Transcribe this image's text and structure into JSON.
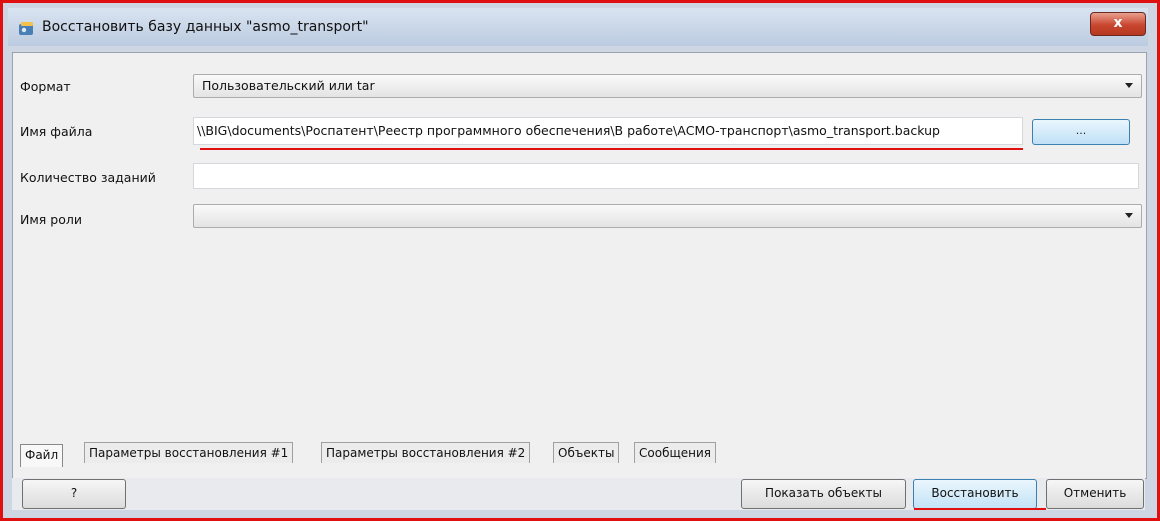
{
  "window": {
    "title": "Восстановить базу данных \"asmo_transport\"",
    "close_label": "x"
  },
  "form": {
    "format_label": "Формат",
    "format_value": "Пользовательский или tar",
    "filename_label": "Имя файла",
    "filename_value": "\\\\BIG\\documents\\Роспатент\\Реестр программного обеспечения\\В работе\\АСМО-транспорт\\asmo_transport.backup",
    "browse_label": "...",
    "jobs_label": "Количество заданий",
    "jobs_value": "",
    "role_label": "Имя роли",
    "role_value": ""
  },
  "tabs": [
    {
      "label": "Файл",
      "active": true
    },
    {
      "label": "Параметры восстановления #1",
      "active": false
    },
    {
      "label": "Параметры восстановления #2",
      "active": false
    },
    {
      "label": "Объекты",
      "active": false
    },
    {
      "label": "Сообщения",
      "active": false
    }
  ],
  "buttons": {
    "help_label": "?",
    "show_objects_label": "Показать объекты",
    "restore_label": "Восстановить",
    "cancel_label": "Отменить"
  },
  "colors": {
    "annotation_red": "#e01010",
    "accent_blue": "#3c7fb1"
  }
}
